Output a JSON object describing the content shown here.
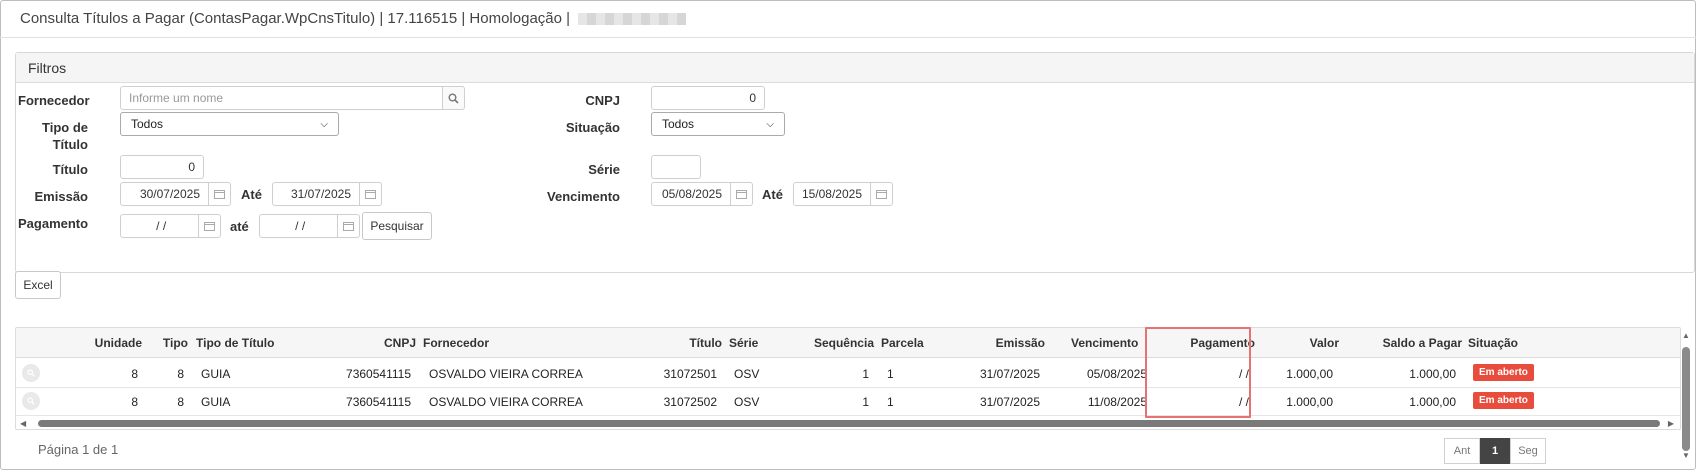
{
  "window": {
    "title": "Consulta Títulos a Pagar (ContasPagar.WpCnsTitulo) | 17.116515 | Homologação |"
  },
  "filters": {
    "header": "Filtros",
    "fornecedor": {
      "label": "Fornecedor",
      "placeholder": "Informe um nome",
      "icon": "search-icon"
    },
    "cnpj": {
      "label": "CNPJ",
      "value": "0"
    },
    "tipo_titulo": {
      "label": "Tipo de Título",
      "value": "Todos"
    },
    "situacao": {
      "label": "Situação",
      "value": "Todos"
    },
    "titulo": {
      "label": "Título",
      "value": "0"
    },
    "serie": {
      "label": "Série",
      "value": ""
    },
    "emissao": {
      "label": "Emissão",
      "from": "30/07/2025",
      "ate_label": "Até",
      "to": "31/07/2025"
    },
    "vencimento": {
      "label": "Vencimento",
      "from": "05/08/2025",
      "ate_label": "Até",
      "to": "15/08/2025"
    },
    "pagamento": {
      "label": "Pagamento",
      "from": " / /",
      "ate_label": "até",
      "to": " / /"
    },
    "search_button": "Pesquisar"
  },
  "toolbar": {
    "excel_button": "Excel"
  },
  "table": {
    "columns": [
      "Unidade",
      "Tipo",
      "Tipo de Título",
      "CNPJ",
      "Fornecedor",
      "Título",
      "Série",
      "Sequência",
      "Parcela",
      "Emissão",
      "Vencimento",
      "Pagamento",
      "Valor",
      "Saldo a Pagar",
      "Situação"
    ],
    "rows": [
      {
        "unidade": "8",
        "tipo": "8",
        "tipo_titulo": "GUIA",
        "cnpj": "7360541115",
        "fornecedor": "OSVALDO VIEIRA CORREA",
        "titulo": "31072501",
        "serie": "OSV",
        "sequencia": "1",
        "parcela": "1",
        "emissao": "31/07/2025",
        "vencimento": "05/08/2025",
        "pagamento": "/ /",
        "valor": "1.000,00",
        "saldo": "1.000,00",
        "situacao": "Em aberto"
      },
      {
        "unidade": "8",
        "tipo": "8",
        "tipo_titulo": "GUIA",
        "cnpj": "7360541115",
        "fornecedor": "OSVALDO VIEIRA CORREA",
        "titulo": "31072502",
        "serie": "OSV",
        "sequencia": "1",
        "parcela": "1",
        "emissao": "31/07/2025",
        "vencimento": "11/08/2025",
        "pagamento": "/ /",
        "valor": "1.000,00",
        "saldo": "1.000,00",
        "situacao": "Em aberto"
      }
    ]
  },
  "pagination": {
    "info": "Página 1 de 1",
    "prev": "Ant",
    "current": "1",
    "next": "Seg"
  },
  "colors": {
    "badge_open": "#e74c3c",
    "highlight": "#e57373",
    "pager_active": "#444444"
  }
}
